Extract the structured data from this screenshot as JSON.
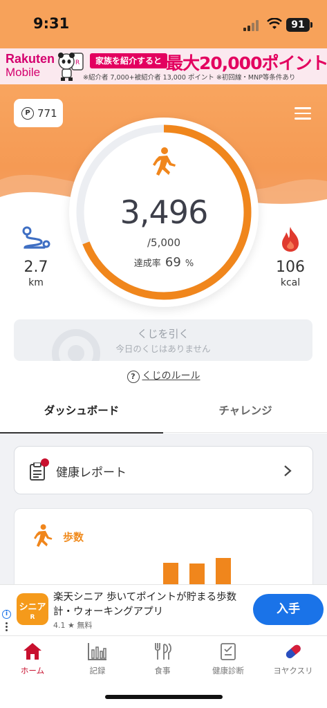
{
  "status_bar": {
    "time": "9:31",
    "battery": "91"
  },
  "banner_ad": {
    "brand_line1": "Rakuten",
    "brand_line2": "Mobile",
    "pill": "家族を紹介すると",
    "headline": "最大20,000ポイント!",
    "note": "※紹介者 7,000+被紹介者 13,000 ポイント ※初回線・MNP等条件あり"
  },
  "header": {
    "points": "771",
    "points_icon": "P"
  },
  "progress": {
    "steps": "3,496",
    "goal": "/5,000",
    "rate_label": "達成率",
    "rate_value": "69",
    "rate_unit": "%",
    "fraction": 0.69,
    "color": "#f0861c"
  },
  "distance": {
    "value": "2.7",
    "unit": "km"
  },
  "calories": {
    "value": "106",
    "unit": "kcal"
  },
  "lottery": {
    "title": "くじを引く",
    "subtitle": "今日のくじはありません"
  },
  "rules_link": "くじのルール",
  "tabs": [
    {
      "label": "ダッシュボード",
      "active": true
    },
    {
      "label": "チャレンジ",
      "active": false
    }
  ],
  "report_card": {
    "label": "健康レポート"
  },
  "steps_card": {
    "title": "歩数"
  },
  "bottom_ad": {
    "icon_line1": "シニア",
    "icon_line2": "R",
    "title": "楽天シニア 歩いてポイントが貯まる歩数計・ウォーキングアプリ",
    "rating": "4.1 ★ 無料",
    "button": "入手"
  },
  "nav": [
    {
      "label": "ホーム",
      "icon": "home-icon",
      "active": true
    },
    {
      "label": "記録",
      "icon": "chart-icon",
      "active": false
    },
    {
      "label": "食事",
      "icon": "meal-icon",
      "active": false
    },
    {
      "label": "健康診断",
      "icon": "checkup-icon",
      "active": false
    },
    {
      "label": "ヨヤクスリ",
      "icon": "pill-icon",
      "active": false
    }
  ]
}
